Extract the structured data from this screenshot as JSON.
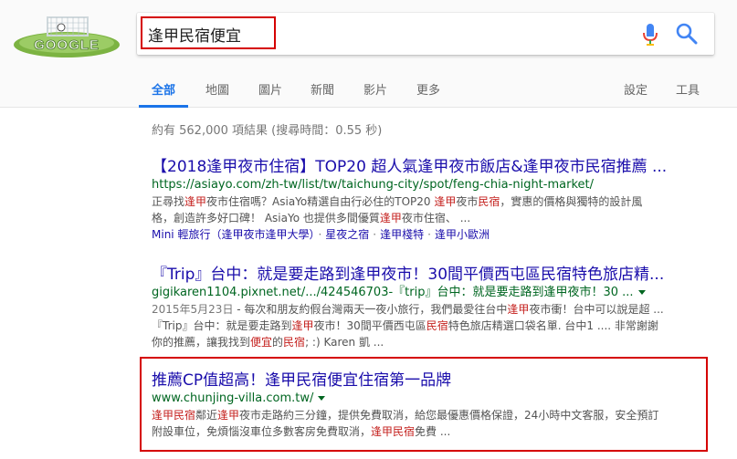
{
  "search": {
    "query": "逢甲民宿便宜"
  },
  "tabs": {
    "all": "全部",
    "maps": "地圖",
    "images": "圖片",
    "news": "新聞",
    "videos": "影片",
    "more": "更多",
    "settings": "設定",
    "tools": "工具"
  },
  "stats": "約有 562,000 項結果 (搜尋時間：0.55 秒)",
  "results": [
    {
      "title": "【2018逢甲夜市住宿】TOP20 超人氣逢甲夜市飯店&逢甲夜市民宿推薦 ...",
      "url": "https://asiayo.com/zh-tw/list/tw/taichung-city/spot/feng-chia-night-market/",
      "s1": [
        "正尋找",
        "逢甲",
        "夜市住宿嗎？AsiaYo精選自由行必住的TOP20 ",
        "逢甲",
        "夜市",
        "民宿",
        "，實惠的價格與獨特的設計風"
      ],
      "s2": [
        "格，創造許多好口碑！ AsiaYo 也提供多間優質",
        "逢甲",
        "夜市住宿、 ..."
      ],
      "links": [
        "Mini 輕旅行（逢甲夜市逢甲大學）",
        "星夜之宿",
        "逢甲棧特",
        "逢甲小歐洲"
      ]
    },
    {
      "title": "『Trip』台中：就是要走路到逢甲夜市！30間平價西屯區民宿特色旅店精...",
      "url": "gigikaren1104.pixnet.net/.../424546703-『trip』台中：就是要走路到逢甲夜市！30 ...",
      "s1_date": "2015年5月23日",
      "s1": [
        " - 每次和朋友約假台灣兩天一夜小旅行，我們最愛往台中",
        "逢甲",
        "夜市衝！台中可以說是超 ..."
      ],
      "s2": [
        "『Trip』台中：就是要走路到",
        "逢甲",
        "夜市！30間平價西屯區",
        "民宿",
        "特色旅店精選口袋名單. 台中1 .... 非常謝謝"
      ],
      "s3": [
        "你的推薦，讓我找到",
        "便宜",
        "的",
        "民宿",
        "; :) Karen 凱 ..."
      ]
    },
    {
      "title": "推薦CP值超高！逢甲民宿便宜住宿第一品牌",
      "url": "www.chunjing-villa.com.tw/",
      "s1": [
        "逢甲民宿",
        "鄰近",
        "逢甲",
        "夜市走路約三分鐘，提供免費取消，給您最優惠價格保證，24小時中文客服，安全預訂"
      ],
      "s2": [
        "附設車位，免煩惱沒車位多數客房免費取消，",
        "逢甲民宿",
        "免費 ..."
      ]
    }
  ],
  "colors": {
    "link": "#1a0dab",
    "url": "#006621",
    "accent": "#1a73e8",
    "highlight_box": "#d50000"
  }
}
